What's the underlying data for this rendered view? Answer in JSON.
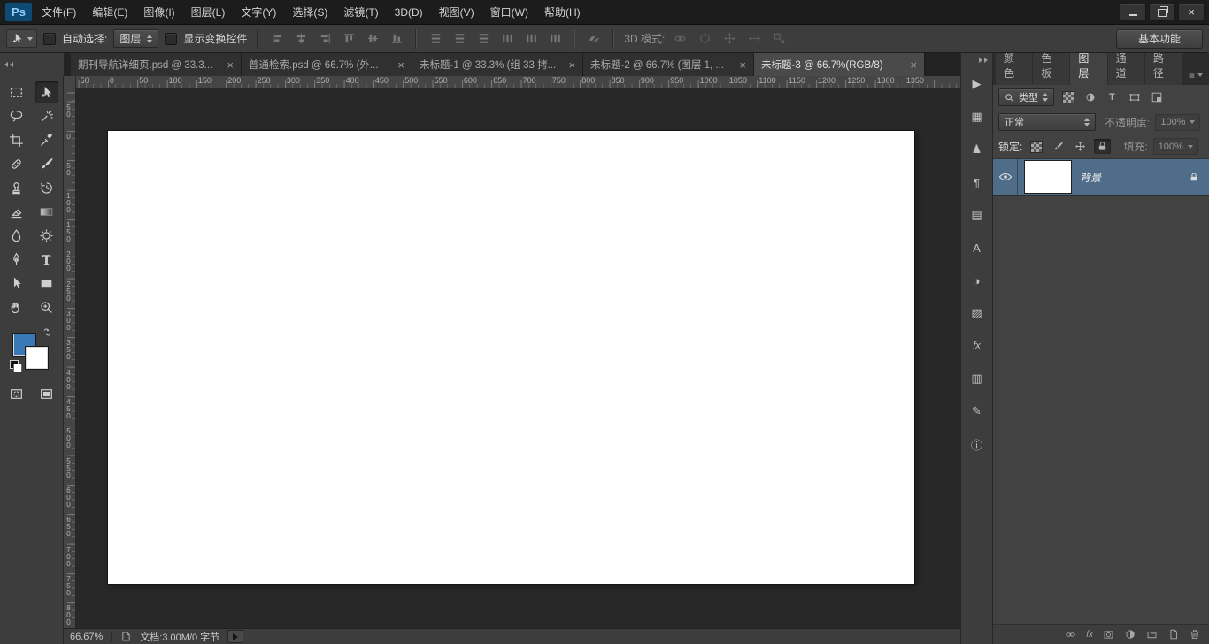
{
  "colors": {
    "foreground_swatch": "#3a79b8",
    "selected_layer": "#4f6d89",
    "panel_bg": "#424242",
    "canvas_bg": "#282828"
  },
  "icons": {
    "close": "×",
    "tab_close": "×",
    "panel_menu": "≡",
    "type_T": "T",
    "fx_label": "fx"
  },
  "menubar": {
    "logo": "Ps",
    "items": [
      {
        "label": "文件(F)"
      },
      {
        "label": "编辑(E)"
      },
      {
        "label": "图像(I)"
      },
      {
        "label": "图层(L)"
      },
      {
        "label": "文字(Y)"
      },
      {
        "label": "选择(S)"
      },
      {
        "label": "滤镜(T)"
      },
      {
        "label": "3D(D)"
      },
      {
        "label": "视图(V)"
      },
      {
        "label": "窗口(W)"
      },
      {
        "label": "帮助(H)"
      }
    ]
  },
  "options_bar": {
    "auto_select_label": "自动选择:",
    "auto_select_value": "图层",
    "show_transform_label": "显示变换控件",
    "mode_3d_label": "3D 模式:",
    "workspace_button": "基本功能"
  },
  "document_tabs": [
    {
      "title": "期刊导航详细页.psd @ 33.3...",
      "active": false
    },
    {
      "title": "普通检索.psd @ 66.7% (外...",
      "active": false
    },
    {
      "title": "未标题-1 @ 33.3% (组 33 拷...",
      "active": false
    },
    {
      "title": "未标题-2 @ 66.7% (图层 1, ...",
      "active": false
    },
    {
      "title": "未标题-3 @ 66.7%(RGB/8)",
      "active": true
    }
  ],
  "rulers": {
    "horizontal": [
      "50",
      "0",
      "50",
      "100",
      "150",
      "200",
      "250",
      "300",
      "350",
      "400",
      "450",
      "500",
      "550",
      "600",
      "650",
      "700",
      "750",
      "800",
      "850",
      "900",
      "950",
      "1000",
      "1050",
      "1100",
      "1150",
      "1200",
      "1250",
      "1300",
      "1350"
    ],
    "vertical": [
      "50",
      "0",
      "50",
      "100",
      "150",
      "200",
      "250",
      "300",
      "350",
      "400",
      "450",
      "500",
      "550",
      "600",
      "650",
      "700",
      "750",
      "800"
    ]
  },
  "panel_tabs": [
    {
      "label": "颜色",
      "active": false
    },
    {
      "label": "色板",
      "active": false
    },
    {
      "label": "图层",
      "active": true
    },
    {
      "label": "通道",
      "active": false
    },
    {
      "label": "路径",
      "active": false
    }
  ],
  "strip_icons": [
    {
      "name": "actions",
      "glyph": "▶"
    },
    {
      "name": "tool-presets",
      "glyph": "▦"
    },
    {
      "name": "clone-source",
      "glyph": "♟"
    },
    {
      "name": "paragraph",
      "glyph": "¶"
    },
    {
      "name": "layer-comps",
      "glyph": "▤"
    },
    {
      "name": "character",
      "glyph": "A"
    },
    {
      "name": "adjustments",
      "glyph": "◑"
    },
    {
      "name": "swatches",
      "glyph": "▨"
    },
    {
      "name": "styles",
      "glyph": "fx"
    },
    {
      "name": "histogram",
      "glyph": "▥"
    },
    {
      "name": "notes",
      "glyph": "✎"
    },
    {
      "name": "info",
      "glyph": "ⓘ"
    }
  ],
  "layers_panel": {
    "filter_label": "类型",
    "blend_mode": "正常",
    "opacity_label": "不透明度:",
    "opacity_value": "100%",
    "lock_label": "锁定:",
    "fill_label": "填充:",
    "fill_value": "100%",
    "layers": [
      {
        "name": "背景",
        "visible": true,
        "locked": true,
        "selected": true
      }
    ]
  },
  "status_bar": {
    "zoom": "66.67%",
    "doc_info": "文档:3.00M/0 字节"
  }
}
